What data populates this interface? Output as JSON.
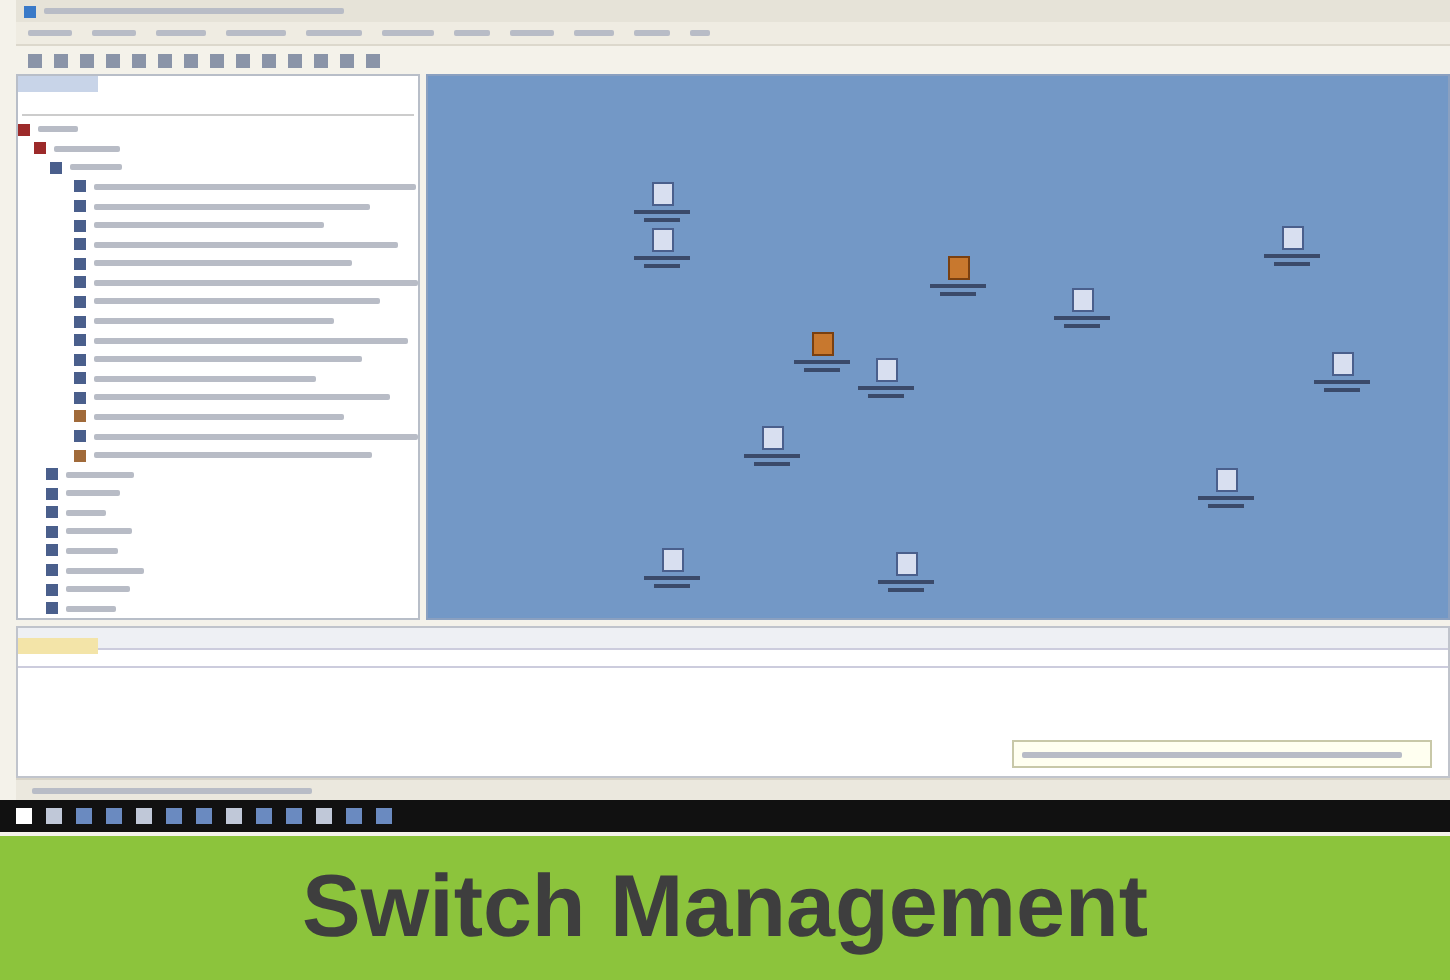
{
  "caption": {
    "title": "Switch Management"
  }
}
